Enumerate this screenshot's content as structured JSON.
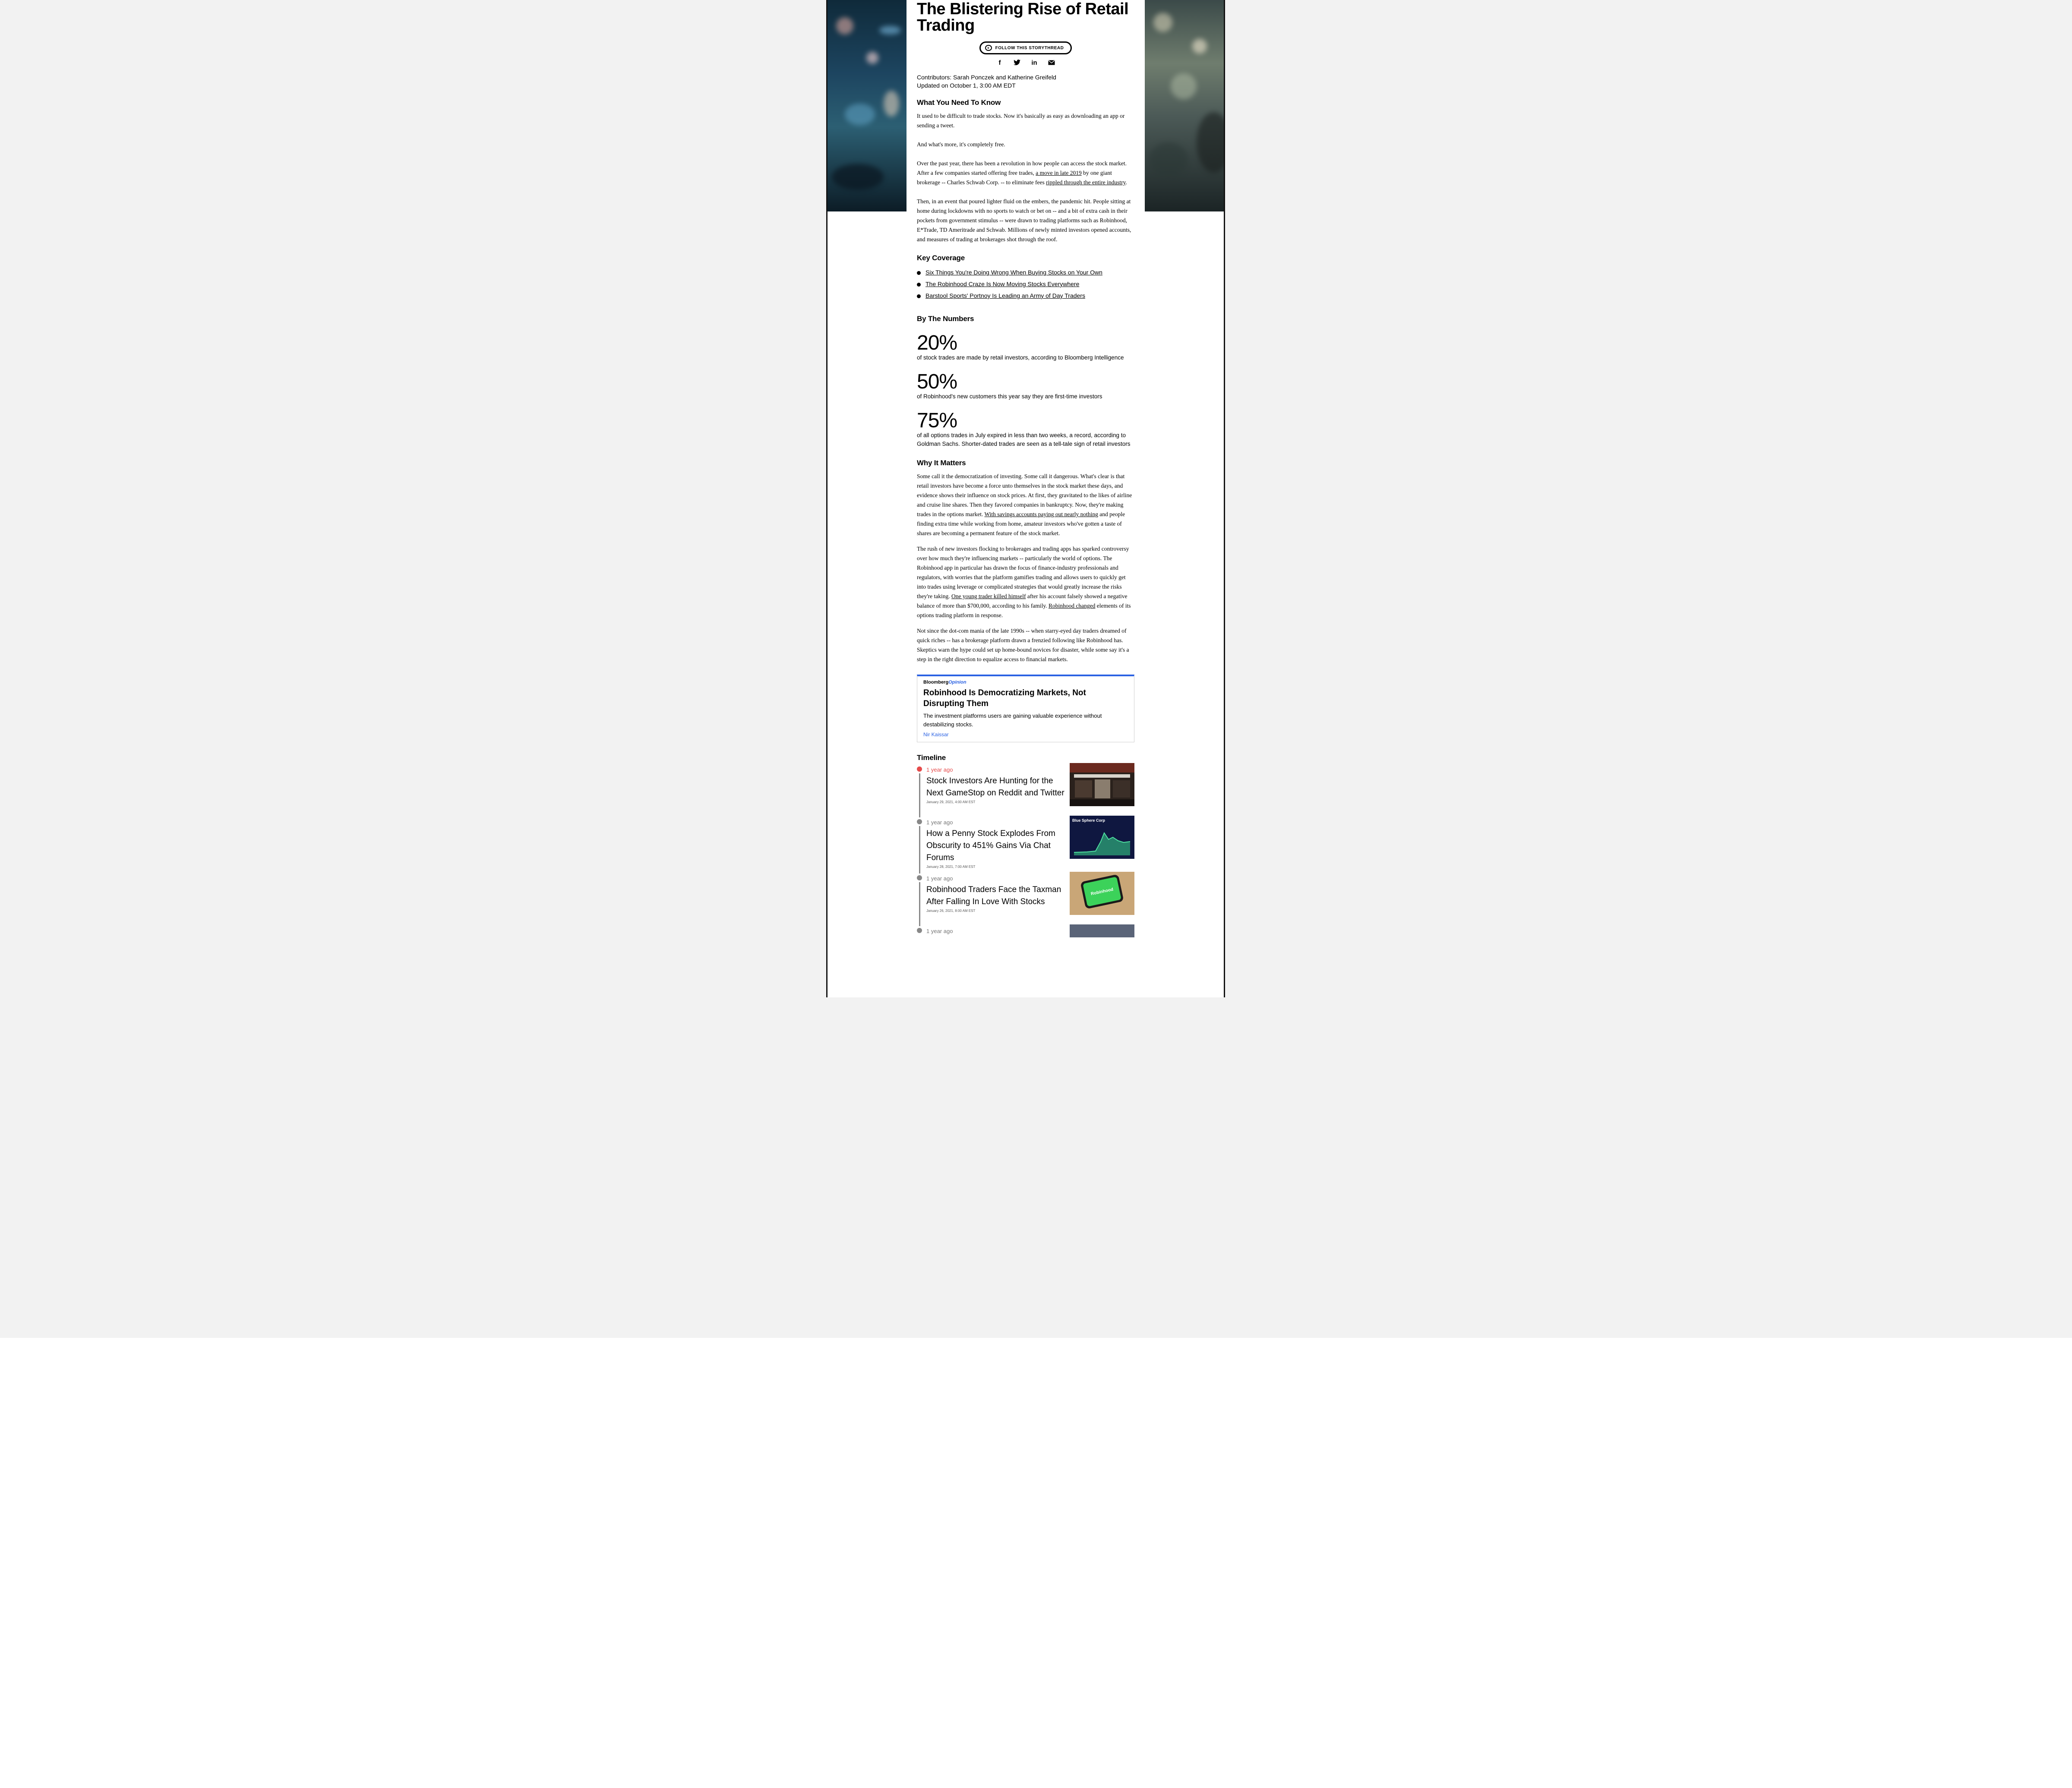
{
  "article": {
    "title": "The Blistering Rise of Retail Trading",
    "follow_label": "FOLLOW THIS STORYTHREAD",
    "contributors": "Contributors: Sarah Ponczek and Katherine Greifeld",
    "updated": "Updated on October 1, 3:00 AM EDT"
  },
  "share_icons": [
    "facebook-icon",
    "twitter-icon",
    "linkedin-icon",
    "email-icon"
  ],
  "what_to_know": {
    "heading": "What You Need To Know",
    "p1": "It used to be difficult to trade stocks. Now it's basically as easy as downloading an app or sending a tweet.",
    "p2": "And what's more, it's completely free.",
    "p3_a": "Over the past year, there has been a revolution in how people can access the stock market. After a few companies started offering free trades, ",
    "p3_link1": "a move in late 2019",
    "p3_b": " by one giant brokerage -- Charles Schwab Corp. -- to eliminate fees ",
    "p3_link2": "rippled through the entire industry",
    "p3_c": ".",
    "p4": "Then, in an event that poured lighter fluid on the embers, the pandemic hit. People sitting at home during lockdowns with no sports to watch or bet on -- and a bit of extra cash in their pockets from government stimulus -- were drawn to trading platforms such as Robinhood, E*Trade, TD Ameritrade and Schwab. Millions of newly minted investors opened accounts, and measures of trading at brokerages shot through the roof."
  },
  "key_coverage": {
    "heading": "Key Coverage",
    "items": [
      "Six Things You're Doing Wrong When Buying Stocks on Your Own",
      "The Robinhood Craze Is Now Moving Stocks Everywhere",
      "Barstool Sports' Portnoy Is Leading an Army of Day Traders"
    ]
  },
  "numbers": {
    "heading": "By The Numbers",
    "items": [
      {
        "value": "20%",
        "caption": "of stock trades are made by retail investors, according to Bloomberg Intelligence"
      },
      {
        "value": "50%",
        "caption": "of Robinhood's new customers this year say they are first-time investors"
      },
      {
        "value": "75%",
        "caption": "of all options trades in July expired in less than two weeks, a record, according to Goldman Sachs. Shorter-dated trades are seen as a tell-tale sign of retail investors"
      }
    ]
  },
  "why_it_matters": {
    "heading": "Why It Matters",
    "p1_a": "Some call it the democratization of investing. Some call it dangerous. What's clear is that retail investors have become a force unto themselves in the stock market these days, and evidence shows their influence on stock prices. At first, they gravitated to the likes of airline and cruise line shares. Then they favored companies in bankruptcy. Now, they're making trades in the options market. ",
    "p1_link": "With savings accounts paying out nearly nothing",
    "p1_b": " and people finding extra time while working from home, amateur investors who've gotten a taste of shares are becoming a permanent feature of the stock market.",
    "p2_a": "The rush of new investors flocking to brokerages and trading apps has sparked controversy over how much they're influencing markets -- particularly the world of options. The Robinhood app in particular has drawn the focus of finance-industry professionals and regulators, with worries that the platform gamifies trading and allows users to quickly get into trades using leverage or complicated strategies that would greatly increase the risks they're taking. ",
    "p2_link1": "One young trader killed himself",
    "p2_b": " after his account falsely showed a negative balance of more than $700,000, according to his family. ",
    "p2_link2": "Robinhood changed",
    "p2_c": " elements of its options trading platform in response.",
    "p3": "Not since the dot-com mania of the late 1990s -- when starry-eyed day traders dreamed of quick riches -- has a brokerage platform drawn a frenzied following like Robinhood has. Skeptics warn the hype could set up home-bound novices for disaster, while some say it's a step in the right direction to equalize access to financial markets."
  },
  "opinion": {
    "brand_a": "Bloomberg",
    "brand_b": "Opinion",
    "title": "Robinhood Is Democratizing Markets, Not Disrupting Them",
    "description": "The investment platforms users are gaining valuable experience without destabilizing stocks.",
    "author": "Nir Kaissar"
  },
  "timeline": {
    "heading": "Timeline",
    "items": [
      {
        "ago": "1 year ago",
        "headline": "Stock Investors Are Hunting for the Next GameStop on Reddit and Twitter",
        "date": "January 29, 2021, 4:00 AM EST"
      },
      {
        "ago": "1 year ago",
        "headline": "How a Penny Stock Explodes From Obscurity to 451% Gains Via Chat Forums",
        "date": "January 28, 2021, 7:00 AM EST"
      },
      {
        "ago": "1 year ago",
        "headline": "Robinhood Traders Face the Taxman After Falling In Love With Stocks",
        "date": "January 26, 2021, 8:00 AM EST"
      },
      {
        "ago": "1 year ago"
      }
    ],
    "thumb2_title": "Blue Sphere Corp",
    "thumb3_label": "Robinhood"
  },
  "colors": {
    "accent_blue": "#2b62e3",
    "timeline_red": "#e64b4b",
    "page_gray": "#f2f2f2"
  }
}
